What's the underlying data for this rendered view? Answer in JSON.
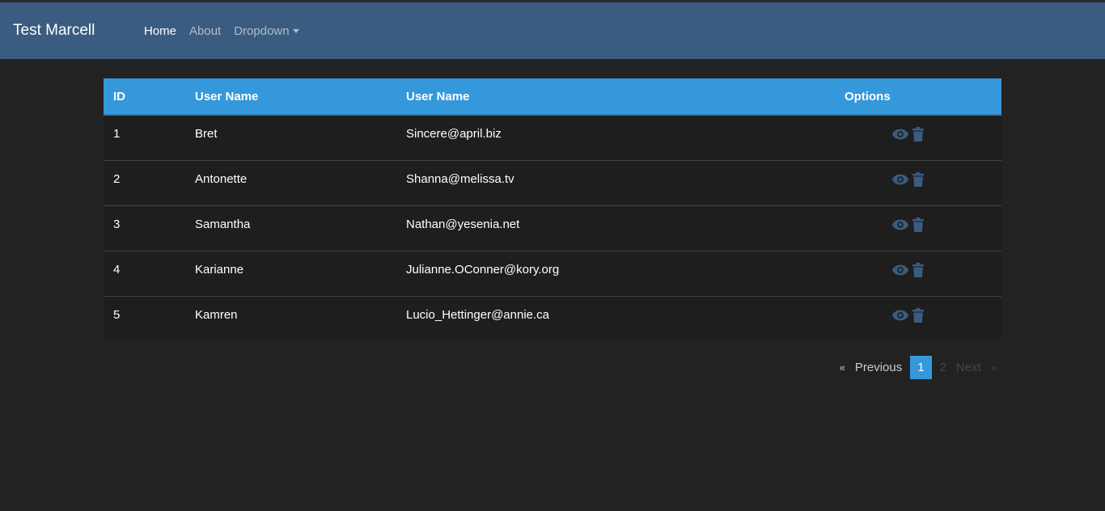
{
  "navbar": {
    "brand": "Test Marcell",
    "links": [
      {
        "label": "Home"
      },
      {
        "label": "About"
      },
      {
        "label": "Dropdown"
      }
    ]
  },
  "table": {
    "headers": [
      "ID",
      "User Name",
      "User Name",
      "Options"
    ],
    "rows": [
      {
        "id": "1",
        "username": "Bret",
        "email": "Sincere@april.biz"
      },
      {
        "id": "2",
        "username": "Antonette",
        "email": "Shanna@melissa.tv"
      },
      {
        "id": "3",
        "username": "Samantha",
        "email": "Nathan@yesenia.net"
      },
      {
        "id": "4",
        "username": "Karianne",
        "email": "Julianne.OConner@kory.org"
      },
      {
        "id": "5",
        "username": "Kamren",
        "email": "Lucio_Hettinger@annie.ca"
      }
    ],
    "option_icons": [
      "eye-icon",
      "trash-icon"
    ]
  },
  "pagination": {
    "prev_arrow": "«",
    "previous": "Previous",
    "pages": [
      "1",
      "2"
    ],
    "active_page": "1",
    "next": "Next",
    "next_arrow": "»"
  },
  "colors": {
    "navbar": "#3a5c80",
    "accent": "#3498db",
    "background": "#222222",
    "icon": "#3a5c80"
  }
}
